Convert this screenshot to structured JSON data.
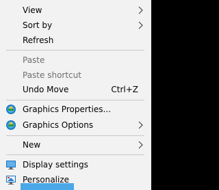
{
  "menu": {
    "view": "View",
    "sort_by": "Sort by",
    "refresh": "Refresh",
    "paste": "Paste",
    "paste_shortcut": "Paste shortcut",
    "undo_move": "Undo Move",
    "undo_move_shortcut": "Ctrl+Z",
    "graphics_properties": "Graphics Properties...",
    "graphics_options": "Graphics Options",
    "new": "New",
    "display_settings": "Display settings",
    "personalize": "Personalize"
  },
  "icons": {
    "graphics_properties": "intel-graphics-icon",
    "graphics_options": "intel-graphics-icon",
    "display_settings": "display-monitor-icon",
    "personalize": "personalize-monitor-icon"
  },
  "colors": {
    "menu_background": "#f2f2f2",
    "separator": "#c8c8c8",
    "disabled_text": "#6d6d6d",
    "hover_highlight": "#4aa8e8",
    "desktop_background": "#000000"
  }
}
